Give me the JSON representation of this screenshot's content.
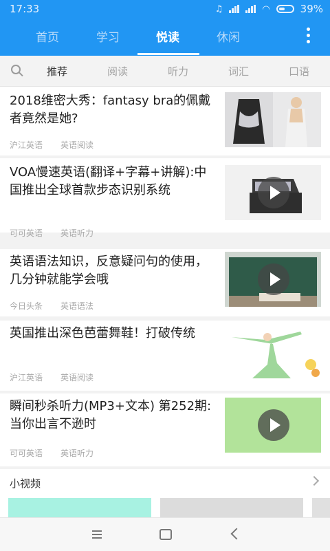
{
  "status_bar": {
    "time": "17:33",
    "battery": "39%"
  },
  "top_tabs": [
    {
      "label": "首页"
    },
    {
      "label": "学习"
    },
    {
      "label": "悦读"
    },
    {
      "label": "休闲"
    }
  ],
  "active_top_tab": "悦读",
  "sub_tabs": [
    {
      "label": "推荐"
    },
    {
      "label": "阅读"
    },
    {
      "label": "听力"
    },
    {
      "label": "词汇"
    },
    {
      "label": "口语"
    }
  ],
  "active_sub_tab": "推荐",
  "articles": [
    {
      "title": "2018维密大秀：fantasy bra的佩戴者竟然是她?",
      "source": "沪江英语",
      "category": "英语阅读",
      "video": false
    },
    {
      "title": "VOA慢速英语(翻译+字幕+讲解):中国推出全球首款步态识别系统",
      "source": "可可英语",
      "category": "英语听力",
      "video": true
    },
    {
      "title": "英语语法知识，反意疑问句的使用，几分钟就能学会哦",
      "source": "今日头条",
      "category": "英语语法",
      "video": true
    },
    {
      "title": "英国推出深色芭蕾舞鞋！打破传统",
      "source": "沪江英语",
      "category": "英语阅读",
      "video": false
    },
    {
      "title": "瞬间秒杀听力(MP3+文本) 第252期:当你出言不逊时",
      "source": "可可英语",
      "category": "英语听力",
      "video": true
    }
  ],
  "short_videos": {
    "label": "小视频"
  },
  "colors": {
    "brand": "#2196f3",
    "thumb_green": "#b2e39a",
    "tile_teal": "#a8f2e2"
  }
}
